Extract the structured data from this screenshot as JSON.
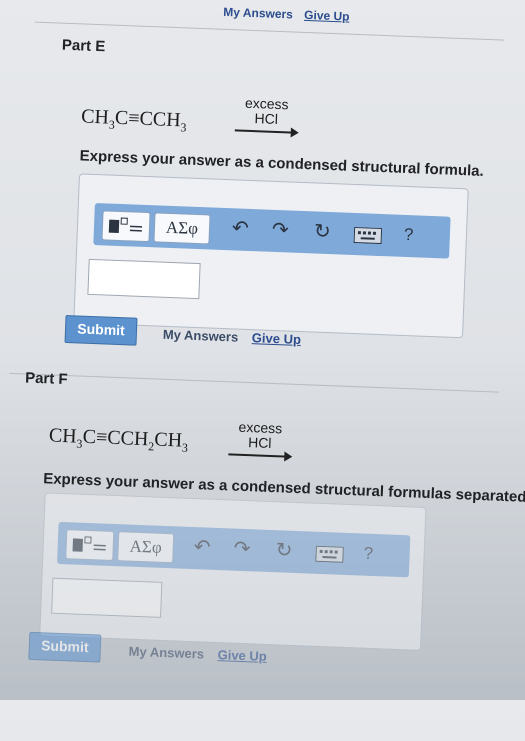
{
  "top": {
    "my_answers": "My Answers",
    "give_up": "Give Up"
  },
  "part_e": {
    "label": "Part E",
    "reactant_html": "CH<sub>3</sub>C&#8801;CCH<sub>3</sub>",
    "reagent_top": "excess",
    "reagent_bottom": "HCl",
    "prompt": "Express your answer as a condensed structural formula.",
    "answer_value": "",
    "submit": "Submit",
    "my_answers": "My Answers",
    "give_up": "Give Up"
  },
  "part_f": {
    "label": "Part F",
    "reactant_html": "CH<sub>3</sub>C&#8801;CCH<sub>2</sub>CH<sub>3</sub>",
    "reagent_top": "excess",
    "reagent_bottom": "HCl",
    "prompt": "Express your answer as a condensed structural formulas separated",
    "answer_value": "",
    "submit": "Submit",
    "my_answers": "My Answers",
    "give_up": "Give Up"
  },
  "toolbar": {
    "greek_label": "ΑΣφ",
    "undo_icon": "undo-icon",
    "redo_icon": "redo-icon",
    "reset_icon": "reset-icon",
    "keyboard_icon": "keyboard-icon",
    "help_label": "?"
  },
  "colors": {
    "toolbar_blue": "#7fa9d9",
    "submit_blue": "#5c93cf",
    "link_blue": "#2c4d8e"
  }
}
